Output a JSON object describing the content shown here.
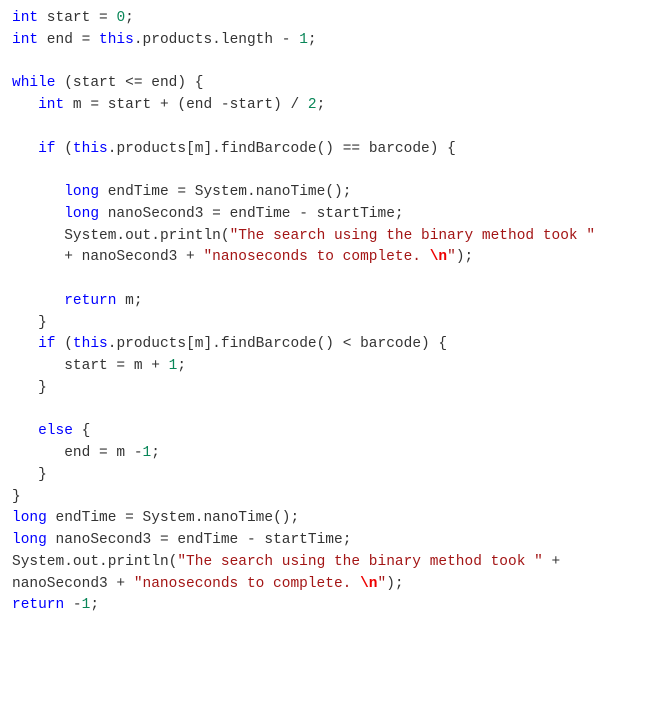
{
  "tokens": [
    [
      [
        "kw",
        "int"
      ],
      [
        "id",
        " start "
      ],
      [
        "op",
        "= "
      ],
      [
        "num",
        "0"
      ],
      [
        "op",
        ";"
      ]
    ],
    [
      [
        "kw",
        "int"
      ],
      [
        "id",
        " end "
      ],
      [
        "op",
        "= "
      ],
      [
        "thisk",
        "this"
      ],
      [
        "op",
        "."
      ],
      [
        "id",
        "products"
      ],
      [
        "op",
        "."
      ],
      [
        "id",
        "length "
      ],
      [
        "op",
        "- "
      ],
      [
        "num",
        "1"
      ],
      [
        "op",
        ";"
      ]
    ],
    [],
    [
      [
        "kw",
        "while"
      ],
      [
        "op",
        " (start "
      ],
      [
        "op",
        "<= "
      ],
      [
        "id",
        "end"
      ],
      [
        "op",
        ") {"
      ]
    ],
    [
      [
        "id",
        "   "
      ],
      [
        "kw",
        "int"
      ],
      [
        "id",
        " m "
      ],
      [
        "op",
        "= "
      ],
      [
        "id",
        "start "
      ],
      [
        "op",
        "+ "
      ],
      [
        "op",
        "("
      ],
      [
        "id",
        "end "
      ],
      [
        "op",
        "-"
      ],
      [
        "id",
        "start"
      ],
      [
        "op",
        ") "
      ],
      [
        "op",
        "/ "
      ],
      [
        "num",
        "2"
      ],
      [
        "op",
        ";"
      ]
    ],
    [],
    [
      [
        "id",
        "   "
      ],
      [
        "kw",
        "if"
      ],
      [
        "op",
        " ("
      ],
      [
        "thisk",
        "this"
      ],
      [
        "op",
        "."
      ],
      [
        "id",
        "products"
      ],
      [
        "op",
        "["
      ],
      [
        "id",
        "m"
      ],
      [
        "op",
        "]."
      ],
      [
        "id",
        "findBarcode"
      ],
      [
        "op",
        "() "
      ],
      [
        "op",
        "== "
      ],
      [
        "id",
        "barcode"
      ],
      [
        "op",
        ") {"
      ]
    ],
    [],
    [
      [
        "id",
        "      "
      ],
      [
        "kw",
        "long"
      ],
      [
        "id",
        " endTime "
      ],
      [
        "op",
        "= "
      ],
      [
        "id",
        "System"
      ],
      [
        "op",
        "."
      ],
      [
        "id",
        "nanoTime"
      ],
      [
        "op",
        "();"
      ]
    ],
    [
      [
        "id",
        "      "
      ],
      [
        "kw",
        "long"
      ],
      [
        "id",
        " nanoSecond3 "
      ],
      [
        "op",
        "= "
      ],
      [
        "id",
        "endTime "
      ],
      [
        "op",
        "- "
      ],
      [
        "id",
        "startTime"
      ],
      [
        "op",
        ";"
      ]
    ],
    [
      [
        "id",
        "      System"
      ],
      [
        "op",
        "."
      ],
      [
        "id",
        "out"
      ],
      [
        "op",
        "."
      ],
      [
        "id",
        "println"
      ],
      [
        "op",
        "("
      ],
      [
        "str",
        "\"The search using the binary method took \""
      ]
    ],
    [
      [
        "id",
        "      "
      ],
      [
        "op",
        "+ "
      ],
      [
        "id",
        "nanoSecond3 "
      ],
      [
        "op",
        "+ "
      ],
      [
        "str",
        "\"nanoseconds to complete. "
      ],
      [
        "esc",
        "\\n"
      ],
      [
        "str",
        "\""
      ],
      [
        "op",
        ");"
      ]
    ],
    [],
    [
      [
        "id",
        "      "
      ],
      [
        "kw",
        "return"
      ],
      [
        "id",
        " m"
      ],
      [
        "op",
        ";"
      ]
    ],
    [
      [
        "id",
        "   "
      ],
      [
        "op",
        "}"
      ]
    ],
    [
      [
        "id",
        "   "
      ],
      [
        "kw",
        "if"
      ],
      [
        "op",
        " ("
      ],
      [
        "thisk",
        "this"
      ],
      [
        "op",
        "."
      ],
      [
        "id",
        "products"
      ],
      [
        "op",
        "["
      ],
      [
        "id",
        "m"
      ],
      [
        "op",
        "]."
      ],
      [
        "id",
        "findBarcode"
      ],
      [
        "op",
        "() "
      ],
      [
        "op",
        "< "
      ],
      [
        "id",
        "barcode"
      ],
      [
        "op",
        ") {"
      ]
    ],
    [
      [
        "id",
        "      start "
      ],
      [
        "op",
        "= "
      ],
      [
        "id",
        "m "
      ],
      [
        "op",
        "+ "
      ],
      [
        "num",
        "1"
      ],
      [
        "op",
        ";"
      ]
    ],
    [
      [
        "id",
        "   "
      ],
      [
        "op",
        "}"
      ]
    ],
    [],
    [
      [
        "id",
        "   "
      ],
      [
        "kw",
        "else"
      ],
      [
        "op",
        " {"
      ]
    ],
    [
      [
        "id",
        "      end "
      ],
      [
        "op",
        "= "
      ],
      [
        "id",
        "m "
      ],
      [
        "op",
        "-"
      ],
      [
        "num",
        "1"
      ],
      [
        "op",
        ";"
      ]
    ],
    [
      [
        "id",
        "   "
      ],
      [
        "op",
        "}"
      ]
    ],
    [
      [
        "op",
        "}"
      ]
    ],
    [
      [
        "kw",
        "long"
      ],
      [
        "id",
        " endTime "
      ],
      [
        "op",
        "= "
      ],
      [
        "id",
        "System"
      ],
      [
        "op",
        "."
      ],
      [
        "id",
        "nanoTime"
      ],
      [
        "op",
        "();"
      ]
    ],
    [
      [
        "kw",
        "long"
      ],
      [
        "id",
        " nanoSecond3 "
      ],
      [
        "op",
        "= "
      ],
      [
        "id",
        "endTime "
      ],
      [
        "op",
        "- "
      ],
      [
        "id",
        "startTime"
      ],
      [
        "op",
        ";"
      ]
    ],
    [
      [
        "id",
        "System"
      ],
      [
        "op",
        "."
      ],
      [
        "id",
        "out"
      ],
      [
        "op",
        "."
      ],
      [
        "id",
        "println"
      ],
      [
        "op",
        "("
      ],
      [
        "str",
        "\"The search using the binary method took \""
      ],
      [
        "op",
        " +"
      ]
    ],
    [
      [
        "id",
        "nanoSecond3 "
      ],
      [
        "op",
        "+ "
      ],
      [
        "str",
        "\"nanoseconds to complete. "
      ],
      [
        "esc",
        "\\n"
      ],
      [
        "str",
        "\""
      ],
      [
        "op",
        ");"
      ]
    ],
    [
      [
        "kw",
        "return"
      ],
      [
        "op",
        " -"
      ],
      [
        "num",
        "1"
      ],
      [
        "op",
        ";"
      ]
    ]
  ]
}
